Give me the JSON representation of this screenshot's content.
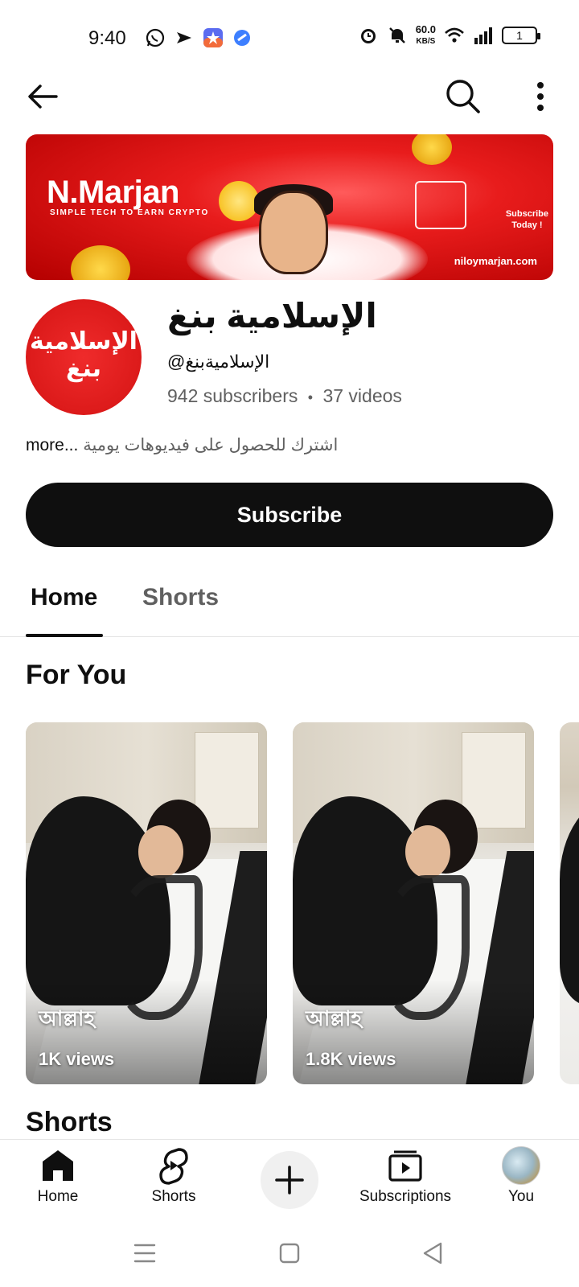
{
  "status_bar": {
    "time": "9:40",
    "net_speed_value": "60.0",
    "net_speed_unit": "KB/S",
    "battery": "1",
    "left_icons": [
      "whatsapp-icon",
      "send-icon",
      "app-star-icon",
      "app-blue-icon"
    ],
    "right_icons": [
      "alarm-icon",
      "mute-icon",
      "wifi-icon",
      "signal-icon",
      "battery-icon"
    ]
  },
  "top_bar": {
    "icons": [
      "back-arrow-icon",
      "search-icon",
      "more-vert-icon"
    ]
  },
  "banner": {
    "brand": "N.Marjan",
    "tagline": "SIMPLE TECH TO EARN CRYPTO",
    "subscribe_line1": "Subscribe",
    "subscribe_line2": "Today !",
    "url": "niloymarjan.com"
  },
  "channel": {
    "avatar_text_line1": "الإسلامية",
    "avatar_text_line2": "بنغ",
    "name": "الإسلامية بنغ",
    "handle": "@الإسلاميةبنغ",
    "subscribers": "942 subscribers",
    "separator": "•",
    "videos": "37 videos",
    "description_more": "more...",
    "description": "اشترك للحصول على فيديوهات يومية"
  },
  "subscribe_button": "Subscribe",
  "tabs": [
    {
      "label": "Home",
      "active": true
    },
    {
      "label": "Shorts",
      "active": false
    }
  ],
  "sections": {
    "for_you": "For You",
    "shorts": "Shorts"
  },
  "shorts_cards": [
    {
      "title": "আল্লাহ",
      "views": "1K views"
    },
    {
      "title": "আল্লাহ",
      "views": "1.8K views"
    }
  ],
  "bottom_nav": [
    {
      "label": "Home",
      "icon": "home-icon"
    },
    {
      "label": "Shorts",
      "icon": "shorts-icon"
    },
    {
      "label": "",
      "icon": "create-plus-icon"
    },
    {
      "label": "Subscriptions",
      "icon": "subscriptions-icon"
    },
    {
      "label": "You",
      "icon": "you-avatar"
    }
  ],
  "colors": {
    "brand_red": "#e81c1c",
    "text_primary": "#0f0f0f",
    "text_secondary": "#606060",
    "button_dark": "#0f0f0f"
  }
}
